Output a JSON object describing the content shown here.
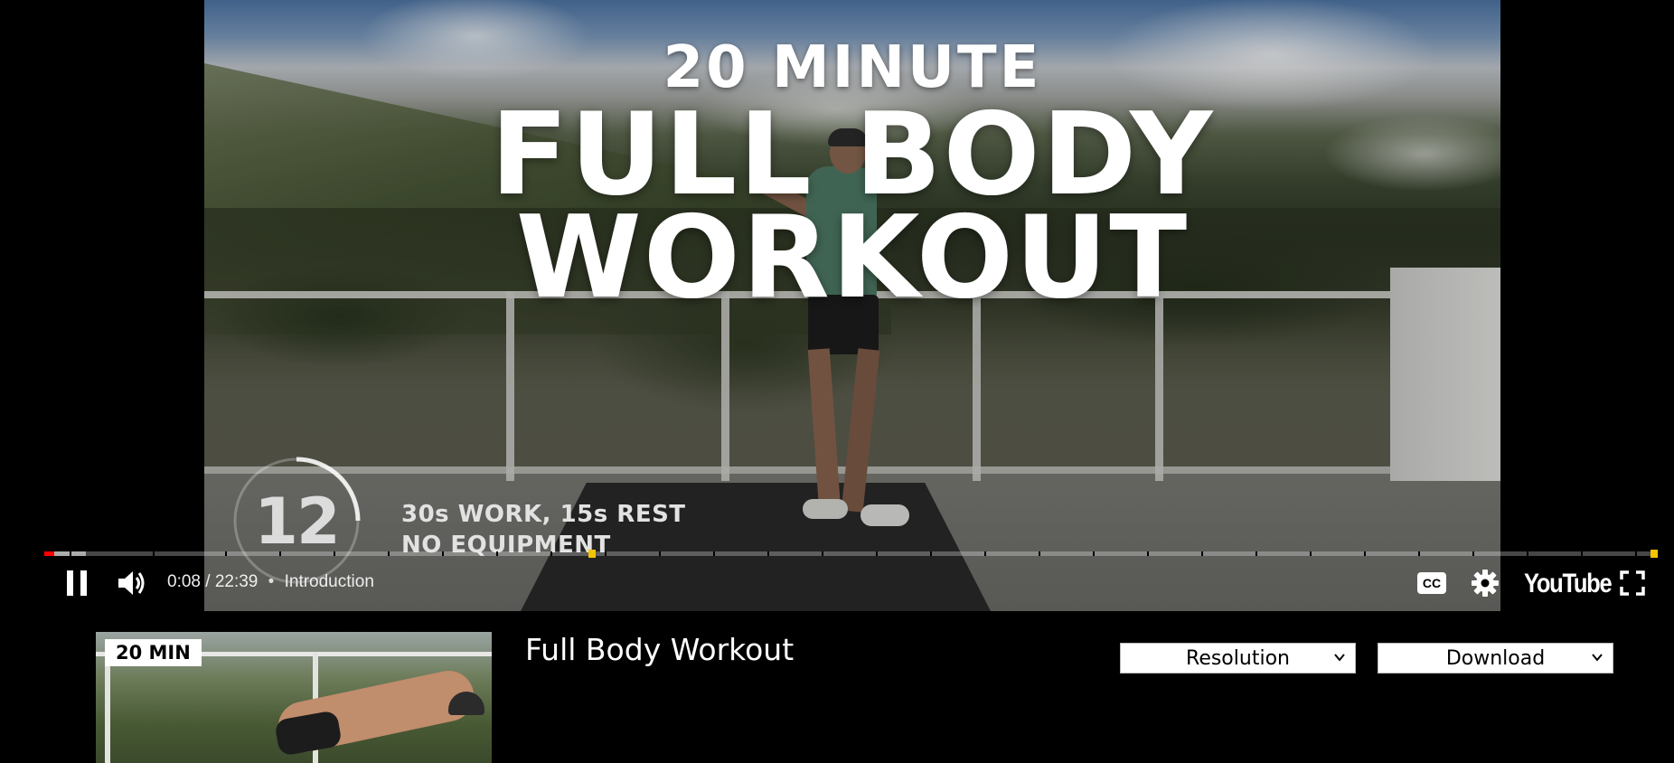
{
  "video": {
    "overlay": {
      "line1": "20 MINUTE",
      "line2": "FULL BODY",
      "line3": "WORKOUT",
      "timer_value": "12",
      "info_1": "30s WORK, 15s REST",
      "info_2": "NO EQUIPMENT"
    }
  },
  "player": {
    "progress_played_fraction": 0.006,
    "progress_buffered_fraction": 0.026,
    "current_time": "0:08",
    "duration": "22:39",
    "separator": "•",
    "chapter": "Introduction",
    "controls": {
      "pause_icon": "pause-icon",
      "volume_icon": "volume-icon",
      "captions_label": "CC",
      "settings_icon": "gear-icon",
      "logo": "YouTube",
      "fullscreen_icon": "fullscreen-icon"
    }
  },
  "details": {
    "thumbnail_badge": "20 MIN",
    "title": "Full Body Workout",
    "resolution_label": "Resolution",
    "download_label": "Download"
  },
  "colors": {
    "progress_played": "#ff0000",
    "chapter_marker": "#f3c400",
    "background": "#000000"
  }
}
